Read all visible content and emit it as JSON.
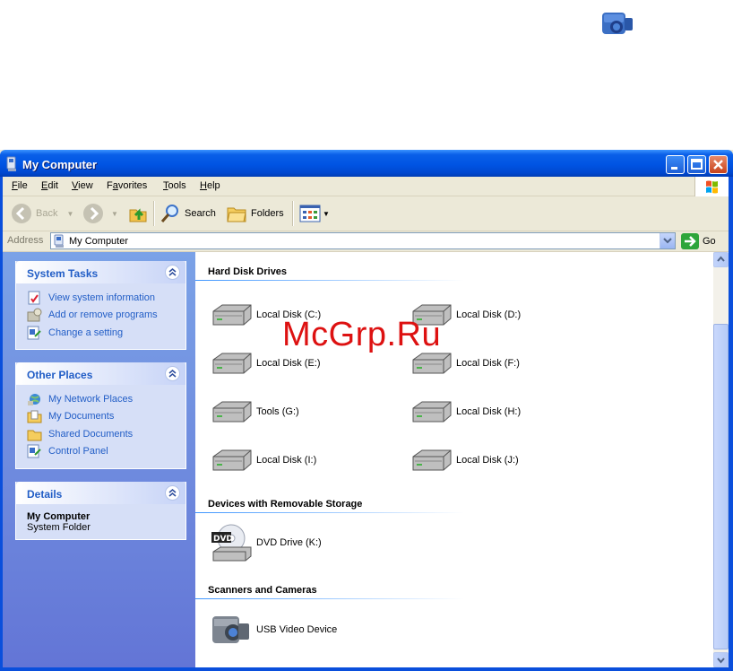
{
  "window": {
    "title": "My Computer",
    "menu": [
      "File",
      "Edit",
      "View",
      "Favorites",
      "Tools",
      "Help"
    ],
    "menu_accel": [
      "F",
      "E",
      "V",
      "a",
      "T",
      "H"
    ]
  },
  "toolbar": {
    "back_label": "Back",
    "search_label": "Search",
    "folders_label": "Folders"
  },
  "address": {
    "label": "Address",
    "value": "My Computer",
    "go_label": "Go"
  },
  "system_tasks": {
    "title": "System Tasks",
    "items": [
      "View system information",
      "Add or remove programs",
      "Change a setting"
    ]
  },
  "other_places": {
    "title": "Other Places",
    "items": [
      "My Network Places",
      "My Documents",
      "Shared Documents",
      "Control Panel"
    ]
  },
  "details": {
    "title": "Details",
    "name": "My Computer",
    "type": "System Folder"
  },
  "groups": {
    "hard_disks": {
      "title": "Hard Disk Drives",
      "items": [
        "Local Disk (C:)",
        "Local Disk (D:)",
        "Local Disk (E:)",
        "Local Disk (F:)",
        "Tools (G:)",
        "Local Disk (H:)",
        "Local Disk (I:)",
        "Local Disk (J:)"
      ]
    },
    "removable": {
      "title": "Devices with Removable Storage",
      "items": [
        "DVD Drive (K:)"
      ],
      "dvd_badge": "DVD"
    },
    "scanners": {
      "title": "Scanners and Cameras",
      "items": [
        "USB Video Device"
      ]
    }
  },
  "watermark": "McGrp.Ru",
  "colors": {
    "titlebar": "#0054e3",
    "taskpane": "#6f8fde",
    "link": "#215dc6",
    "group_line": "#3d95ff",
    "watermark": "#dd1111"
  },
  "icons": [
    "camcorder-icon",
    "my-computer-icon",
    "back-icon",
    "forward-icon",
    "up-folder-icon",
    "search-icon",
    "folders-icon",
    "views-icon",
    "go-arrow-icon",
    "windows-flag-icon",
    "hard-disk-icon",
    "dvd-drive-icon",
    "collapse-chevron-icon"
  ]
}
